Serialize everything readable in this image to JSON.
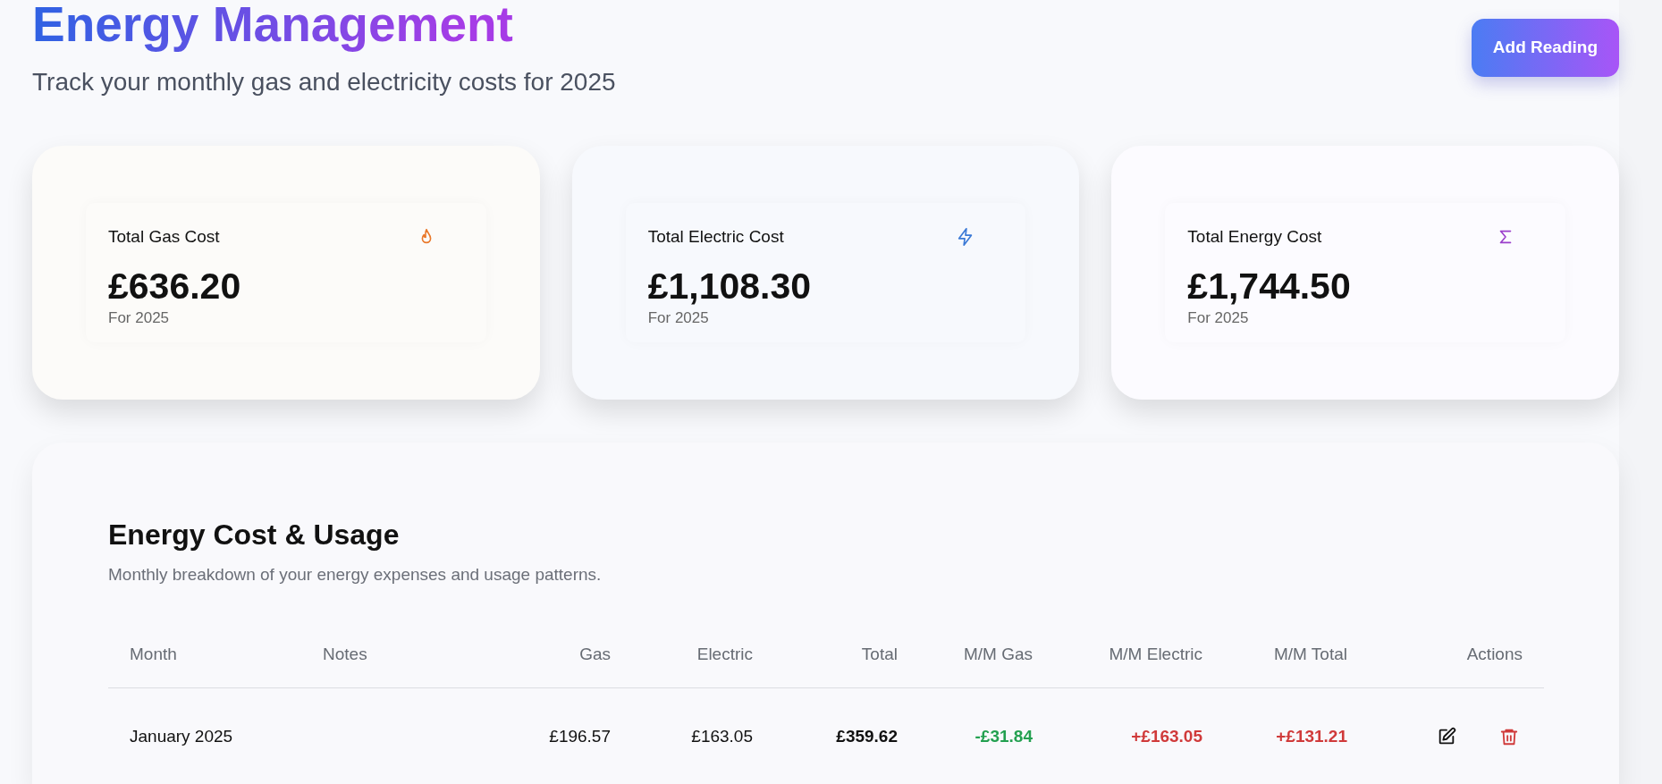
{
  "header": {
    "title": "Energy Management",
    "subtitle": "Track your monthly gas and electricity costs for 2025",
    "button": "Add Reading"
  },
  "summary_cards": [
    {
      "kind": "gas",
      "label": "Total Gas Cost",
      "amount": "£636.20",
      "period": "For 2025"
    },
    {
      "kind": "electric",
      "label": "Total Electric Cost",
      "amount": "£1,108.30",
      "period": "For 2025"
    },
    {
      "kind": "total",
      "label": "Total Energy Cost",
      "amount": "£1,744.50",
      "period": "For 2025"
    }
  ],
  "table": {
    "title": "Energy Cost & Usage",
    "subtitle": "Monthly breakdown of your energy expenses and usage patterns.",
    "columns": [
      "Month",
      "Notes",
      "Gas",
      "Electric",
      "Total",
      "M/M Gas",
      "M/M Electric",
      "M/M Total",
      "Actions"
    ],
    "rows": [
      {
        "month": "January 2025",
        "gas": "£196.57",
        "electric": "£163.05",
        "total": "£359.62",
        "mm_gas": {
          "text": "-£31.84",
          "color": "#23a050"
        },
        "mm_electric": {
          "text": "+£163.05",
          "color": "#d03a3a"
        },
        "mm_total": {
          "text": "+£131.21",
          "color": "#d03a3a"
        }
      }
    ]
  }
}
